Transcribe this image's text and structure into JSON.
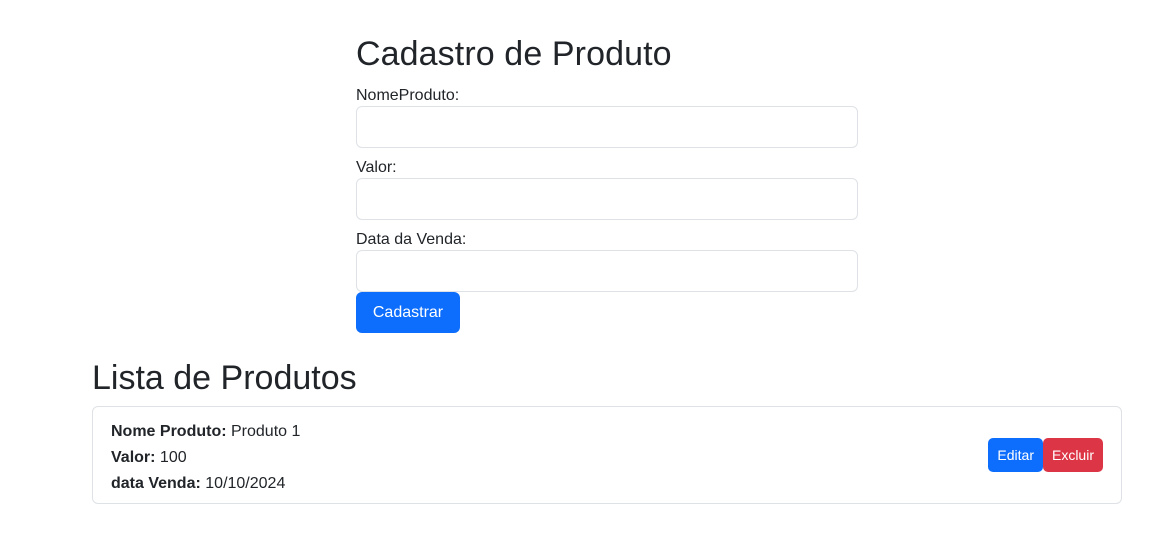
{
  "form": {
    "title": "Cadastro de Produto",
    "fields": [
      {
        "label": "NomeProduto:",
        "value": "",
        "placeholder": ""
      },
      {
        "label": "Valor:",
        "value": "",
        "placeholder": ""
      },
      {
        "label": "Data da Venda:",
        "value": "",
        "placeholder": ""
      }
    ],
    "submit_label": "Cadastrar"
  },
  "list": {
    "title": "Lista de Produtos",
    "items": [
      {
        "name_key": "Nome Produto:",
        "name_value": "Produto 1",
        "value_key": "Valor:",
        "value_value": "100",
        "date_key": "data Venda:",
        "date_value": "10/10/2024",
        "edit_label": "Editar",
        "delete_label": "Excluir"
      }
    ]
  },
  "colors": {
    "primary": "#0d6efd",
    "danger": "#dc3545",
    "text": "#212529",
    "border": "#dee2e6"
  }
}
